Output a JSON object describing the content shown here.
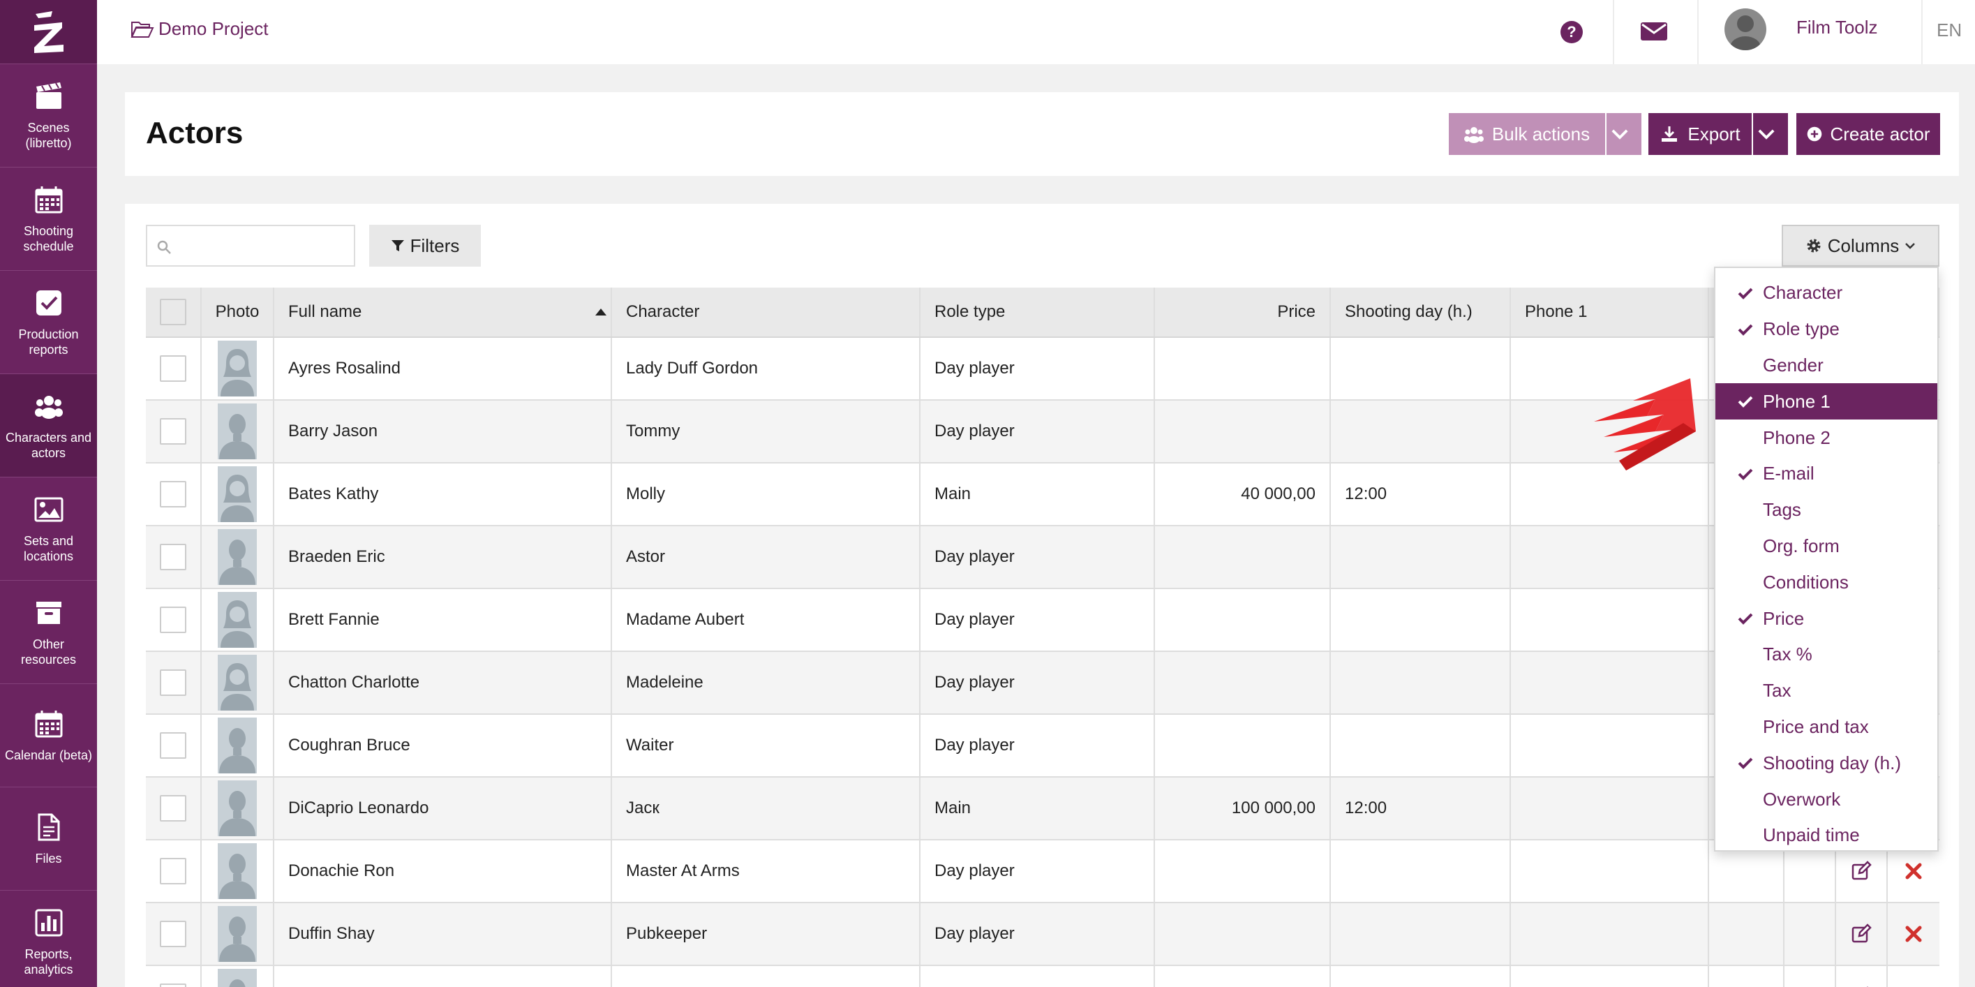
{
  "app": {
    "project_name": "Demo Project",
    "user_name": "Film Toolz",
    "language": "EN"
  },
  "sidebar": {
    "items": [
      {
        "label": "Scenes (libretto)",
        "icon": "clapperboard-icon"
      },
      {
        "label": "Shooting schedule",
        "icon": "calendar-icon"
      },
      {
        "label": "Production reports",
        "icon": "checkbox-icon"
      },
      {
        "label": "Characters and actors",
        "icon": "users-icon"
      },
      {
        "label": "Sets and locations",
        "icon": "image-icon"
      },
      {
        "label": "Other resources",
        "icon": "archive-icon"
      },
      {
        "label": "Calendar (beta)",
        "icon": "calendar-icon"
      },
      {
        "label": "Files",
        "icon": "file-icon"
      },
      {
        "label": "Reports, analytics",
        "icon": "bar-chart-icon"
      }
    ]
  },
  "page": {
    "title": "Actors",
    "bulk_actions_label": "Bulk actions",
    "export_label": "Export",
    "create_label": "Create actor"
  },
  "toolbar": {
    "search_placeholder": "",
    "filters_label": "Filters",
    "columns_label": "Columns"
  },
  "table": {
    "headers": {
      "photo": "Photo",
      "full_name": "Full name",
      "character": "Character",
      "role_type": "Role type",
      "price": "Price",
      "shooting_day": "Shooting day (h.)",
      "phone1": "Phone 1"
    },
    "rows": [
      {
        "full_name": "Ayres Rosalind",
        "character": "Lady Duff Gordon",
        "role_type": "Day player",
        "price": "",
        "shooting_day": "",
        "gender": "female"
      },
      {
        "full_name": "Barry Jason",
        "character": "Tommy",
        "role_type": "Day player",
        "price": "",
        "shooting_day": "",
        "gender": "male"
      },
      {
        "full_name": "Bates Kathy",
        "character": "Molly",
        "role_type": "Main",
        "price": "40 000,00",
        "shooting_day": "12:00",
        "gender": "female"
      },
      {
        "full_name": "Braeden Eric",
        "character": "Astor",
        "role_type": "Day player",
        "price": "",
        "shooting_day": "",
        "gender": "male"
      },
      {
        "full_name": "Brett Fannie",
        "character": "Madame Aubert",
        "role_type": "Day player",
        "price": "",
        "shooting_day": "",
        "gender": "female"
      },
      {
        "full_name": "Chatton Charlotte",
        "character": "Madeleine",
        "role_type": "Day player",
        "price": "",
        "shooting_day": "",
        "gender": "female"
      },
      {
        "full_name": "Coughran Bruce",
        "character": "Waiter",
        "role_type": "Day player",
        "price": "",
        "shooting_day": "",
        "gender": "male"
      },
      {
        "full_name": "DiCaprio Leonardo",
        "character": "Jaск",
        "role_type": "Main",
        "price": "100 000,00",
        "shooting_day": "12:00",
        "gender": "male"
      },
      {
        "full_name": "Donachie Ron",
        "character": "Master At Arms",
        "role_type": "Day player",
        "price": "",
        "shooting_day": "",
        "gender": "male"
      },
      {
        "full_name": "Duffin Shay",
        "character": "Pubkeeper",
        "role_type": "Day player",
        "price": "",
        "shooting_day": "",
        "gender": "male"
      },
      {
        "full_name": "",
        "character": "",
        "role_type": "",
        "price": "",
        "shooting_day": "",
        "gender": "male"
      }
    ]
  },
  "columns_menu": {
    "items": [
      {
        "label": "Character",
        "checked": true,
        "selected": false
      },
      {
        "label": "Role type",
        "checked": true,
        "selected": false
      },
      {
        "label": "Gender",
        "checked": false,
        "selected": false
      },
      {
        "label": "Phone 1",
        "checked": true,
        "selected": true
      },
      {
        "label": "Phone 2",
        "checked": false,
        "selected": false
      },
      {
        "label": "E-mail",
        "checked": true,
        "selected": false
      },
      {
        "label": "Tags",
        "checked": false,
        "selected": false
      },
      {
        "label": "Org. form",
        "checked": false,
        "selected": false
      },
      {
        "label": "Conditions",
        "checked": false,
        "selected": false
      },
      {
        "label": "Price",
        "checked": true,
        "selected": false
      },
      {
        "label": "Tax %",
        "checked": false,
        "selected": false
      },
      {
        "label": "Tax",
        "checked": false,
        "selected": false
      },
      {
        "label": "Price and tax",
        "checked": false,
        "selected": false
      },
      {
        "label": "Shooting day (h.)",
        "checked": true,
        "selected": false
      },
      {
        "label": "Overwork",
        "checked": false,
        "selected": false
      },
      {
        "label": "Unpaid time",
        "checked": false,
        "selected": false
      }
    ]
  },
  "colors": {
    "brand": "#6b2460",
    "brand_light": "#c090b7",
    "delete": "#d0312d",
    "arrow": "#e8272a"
  }
}
